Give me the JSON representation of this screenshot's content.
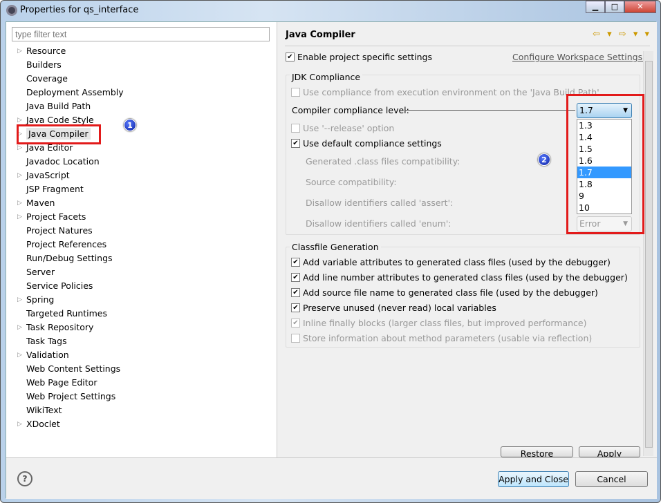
{
  "window": {
    "title": "Properties for qs_interface",
    "minimize": "▁",
    "maximize": "□",
    "close": "✕"
  },
  "filter": {
    "placeholder": "type filter text"
  },
  "tree": [
    {
      "label": "Resource",
      "expandable": true
    },
    {
      "label": "Builders"
    },
    {
      "label": "Coverage"
    },
    {
      "label": "Deployment Assembly"
    },
    {
      "label": "Java Build Path"
    },
    {
      "label": "Java Code Style",
      "expandable": true
    },
    {
      "label": "Java Compiler",
      "expandable": true,
      "selected": true
    },
    {
      "label": "Java Editor",
      "expandable": true
    },
    {
      "label": "Javadoc Location"
    },
    {
      "label": "JavaScript",
      "expandable": true
    },
    {
      "label": "JSP Fragment"
    },
    {
      "label": "Maven",
      "expandable": true
    },
    {
      "label": "Project Facets",
      "expandable": true
    },
    {
      "label": "Project Natures"
    },
    {
      "label": "Project References"
    },
    {
      "label": "Run/Debug Settings"
    },
    {
      "label": "Server"
    },
    {
      "label": "Service Policies"
    },
    {
      "label": "Spring",
      "expandable": true
    },
    {
      "label": "Targeted Runtimes"
    },
    {
      "label": "Task Repository",
      "expandable": true
    },
    {
      "label": "Task Tags"
    },
    {
      "label": "Validation",
      "expandable": true
    },
    {
      "label": "Web Content Settings"
    },
    {
      "label": "Web Page Editor"
    },
    {
      "label": "Web Project Settings"
    },
    {
      "label": "WikiText"
    },
    {
      "label": "XDoclet",
      "expandable": true
    }
  ],
  "page": {
    "title": "Java Compiler",
    "nav": "⇦ ▾ ⇨ ▾ ▾",
    "enable_specific": "Enable project specific settings",
    "configure_link": "Configure Workspace Settings...",
    "jdk": {
      "group": "JDK Compliance",
      "use_ee": "Use compliance from execution environment on the 'Java Build Path'",
      "level_label": "Compiler compliance level:",
      "level_value": "1.7",
      "options": [
        "1.3",
        "1.4",
        "1.5",
        "1.6",
        "1.7",
        "1.8",
        "9",
        "10"
      ],
      "release": "Use '--release' option",
      "use_default": "Use default compliance settings",
      "generated": "Generated .class files compatibility:",
      "source": "Source compatibility:",
      "assert": "Disallow identifiers called 'assert':",
      "enum": "Disallow identifiers called 'enum':",
      "enum_value": "Error"
    },
    "classfile": {
      "group": "Classfile Generation",
      "items": [
        {
          "label": "Add variable attributes to generated class files (used by the debugger)",
          "checked": true
        },
        {
          "label": "Add line number attributes to generated class files (used by the debugger)",
          "checked": true
        },
        {
          "label": "Add source file name to generated class file (used by the debugger)",
          "checked": true
        },
        {
          "label": "Preserve unused (never read) local variables",
          "checked": true
        },
        {
          "label": "Inline finally blocks (larger class files, but improved performance)",
          "checked": true,
          "disabled": true
        },
        {
          "label": "Store information about method parameters (usable via reflection)",
          "checked": false,
          "disabled": true
        }
      ]
    },
    "restore": "Restore Defaults",
    "apply": "Apply"
  },
  "footer": {
    "help": "?",
    "apply_close": "Apply and Close",
    "cancel": "Cancel"
  },
  "annotations": {
    "one": "1",
    "two": "2",
    "color": "#e21a1a"
  }
}
